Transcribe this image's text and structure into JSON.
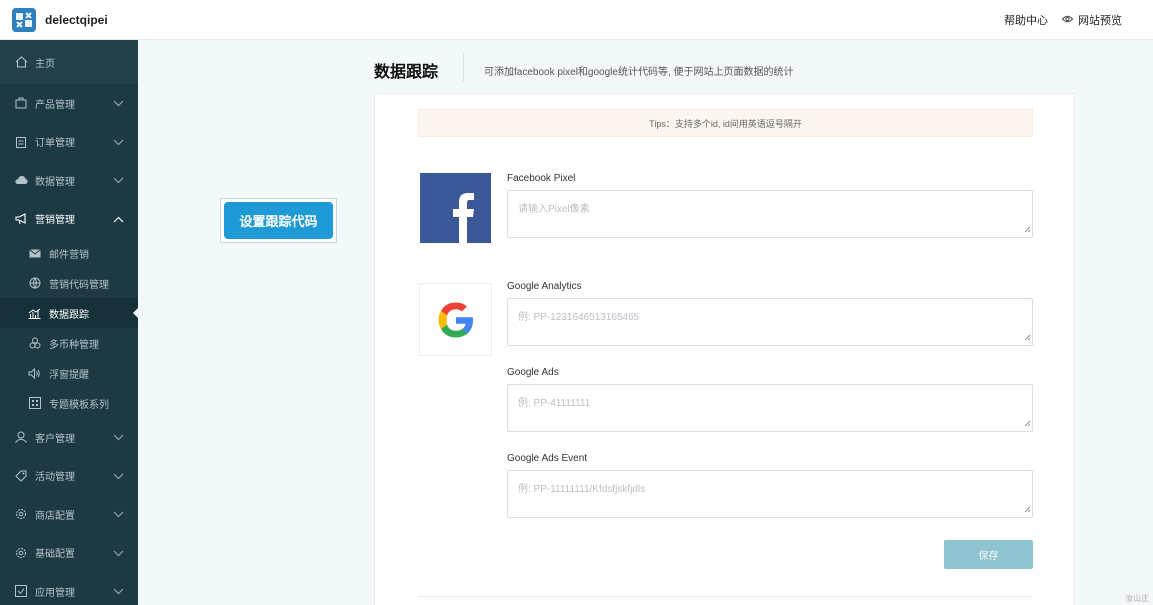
{
  "topbar": {
    "brand": "delectqipei",
    "help_link": "帮助中心",
    "preview_link": "网站预览"
  },
  "sidebar": {
    "home": "主页",
    "groups": [
      {
        "label": "产品管理",
        "icon": "shopping-bag-icon"
      },
      {
        "label": "订单管理",
        "icon": "clipboard-icon"
      },
      {
        "label": "数据管理",
        "icon": "cloud-icon"
      },
      {
        "label": "营销管理",
        "icon": "megaphone-icon"
      }
    ],
    "marketing_subitems": [
      {
        "label": "邮件营销",
        "icon": "mail-icon"
      },
      {
        "label": "营销代码管理",
        "icon": "globe-icon"
      },
      {
        "label": "数据跟踪",
        "icon": "bar-chart-icon"
      },
      {
        "label": "多币种管理",
        "icon": "coins-icon"
      },
      {
        "label": "浮窗提醒",
        "icon": "speaker-icon"
      },
      {
        "label": "专题模板系列",
        "icon": "template-icon"
      }
    ],
    "bottom_groups": [
      {
        "label": "客户管理",
        "icon": "user-icon"
      },
      {
        "label": "活动管理",
        "icon": "tag-icon"
      },
      {
        "label": "商店配置",
        "icon": "gear-icon"
      },
      {
        "label": "基础配置",
        "icon": "gear-icon"
      },
      {
        "label": "应用管理",
        "icon": "app-icon"
      }
    ]
  },
  "callout": "设置跟踪代码",
  "page": {
    "title": "数据跟踪",
    "description": "可添加facebook pixel和google统计代码等, 便于网站上页面数据的统计",
    "tips": "Tips：支持多个id, id间用英语逗号隔开"
  },
  "fields": {
    "facebook_pixel": {
      "label": "Facebook Pixel",
      "placeholder": "请输入Pixel像素"
    },
    "google_analytics": {
      "label": "Google Analytics",
      "placeholder": "例: PP-1231646513165465"
    },
    "google_ads": {
      "label": "Google Ads",
      "placeholder": "例: PP-41111111"
    },
    "google_ads_event": {
      "label": "Google Ads Event",
      "placeholder": "例: PP-11111111/Kfdsfjskfjdls"
    }
  },
  "save_button": "保存",
  "corner_text": "汝山正"
}
